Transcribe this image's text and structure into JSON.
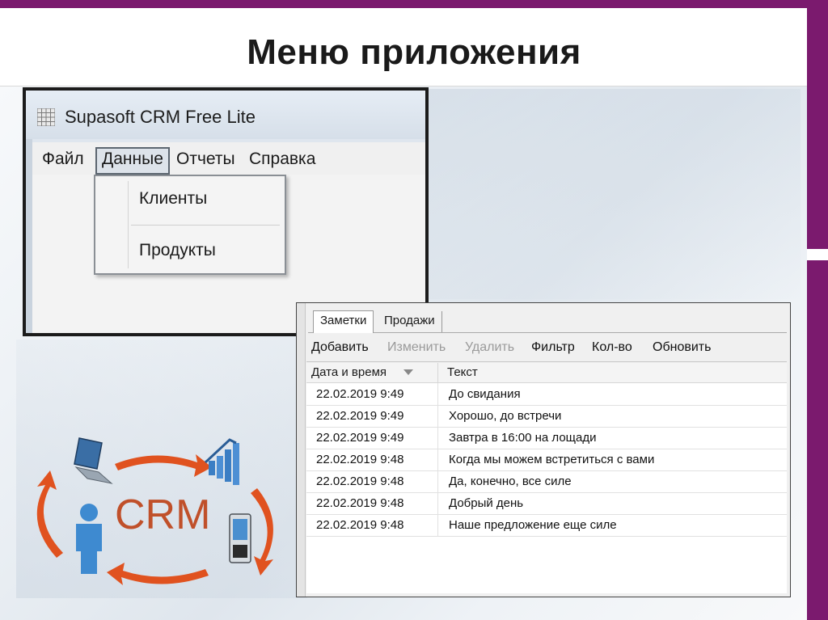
{
  "slide": {
    "title": "Меню приложения",
    "accent_color": "#7b1a6e"
  },
  "main_window": {
    "title": "Supasoft CRM Free Lite",
    "icon": "grid-app-icon",
    "menu": [
      {
        "label": "Файл"
      },
      {
        "label": "Данные",
        "active": true
      },
      {
        "label": "Отчеты"
      },
      {
        "label": "Справка"
      }
    ],
    "dropdown": [
      {
        "label": "Клиенты"
      },
      {
        "label": "Продукты"
      }
    ]
  },
  "notes_window": {
    "tabs": [
      {
        "label": "Заметки",
        "active": true
      },
      {
        "label": "Продажи"
      }
    ],
    "toolbar": [
      {
        "label": "Добавить",
        "enabled": true
      },
      {
        "label": "Изменить",
        "enabled": false
      },
      {
        "label": "Удалить",
        "enabled": false
      },
      {
        "label": "Фильтр",
        "enabled": true
      },
      {
        "label": "Кол-во",
        "enabled": true
      },
      {
        "label": "Обновить",
        "enabled": true
      }
    ],
    "columns": [
      "Дата и время",
      "Текст"
    ],
    "sort_icon": "sort-descending-icon",
    "rows": [
      {
        "date": "22.02.2019 9:49",
        "text": "До свидания"
      },
      {
        "date": "22.02.2019 9:49",
        "text": "Хорошо, до встречи"
      },
      {
        "date": "22.02.2019 9:49",
        "text": "Завтра в 16:00 на лощади"
      },
      {
        "date": "22.02.2019 9:48",
        "text": "Когда мы можем встретиться с вами"
      },
      {
        "date": "22.02.2019 9:48",
        "text": "Да, конечно, все силе"
      },
      {
        "date": "22.02.2019 9:48",
        "text": "Добрый день"
      },
      {
        "date": "22.02.2019 9:48",
        "text": "Наше предложение еще силе"
      }
    ]
  },
  "crm_graphic": {
    "label": "CRM",
    "arrow_color": "#e0521f",
    "label_color": "#c0502a",
    "icons": [
      "laptop-icon",
      "chart-icon",
      "phone-icon",
      "person-icon"
    ]
  }
}
